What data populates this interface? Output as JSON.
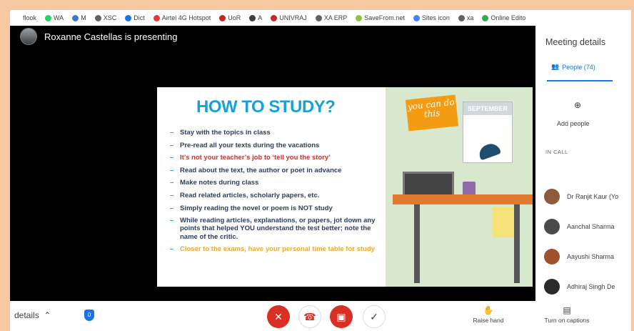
{
  "bookmarks": [
    {
      "label": "flook",
      "color": "#ffffff"
    },
    {
      "label": "WA",
      "color": "#25d366"
    },
    {
      "label": "M",
      "color": "#3c78d8"
    },
    {
      "label": "XSC",
      "color": "#5f6368"
    },
    {
      "label": "Dict",
      "color": "#1a73e8"
    },
    {
      "label": "Airtel 4G Hotspot",
      "color": "#e53935"
    },
    {
      "label": "UoR",
      "color": "#c62828"
    },
    {
      "label": "A",
      "color": "#3c4043"
    },
    {
      "label": "UNIVRAJ",
      "color": "#c62828"
    },
    {
      "label": "XA ERP",
      "color": "#5f6368"
    },
    {
      "label": "SaveFrom.net",
      "color": "#8bc34a"
    },
    {
      "label": "Sites icon",
      "color": "#4285f4"
    },
    {
      "label": "xa",
      "color": "#5f6368"
    },
    {
      "label": "Online Edito",
      "color": "#34a853"
    }
  ],
  "presenter": {
    "text": "Roxanne Castellas is presenting"
  },
  "slide": {
    "title": "HOW TO STUDY?",
    "bullets": [
      {
        "text": "Stay with the topics in class",
        "style": "dark"
      },
      {
        "text": "Pre-read all your texts during the vacations",
        "style": "dark"
      },
      {
        "text": "It’s not your teacher’s job to ‘tell you the story’",
        "style": "red"
      },
      {
        "text": "Read about the text, the author or poet in advance",
        "style": "dark"
      },
      {
        "text": "Make notes during class",
        "style": "dark"
      },
      {
        "text": "Read related articles, scholarly papers, etc.",
        "style": "dark"
      },
      {
        "text": "Simply reading the novel or poem is NOT study",
        "style": "dark"
      },
      {
        "text": "While reading articles, explanations, or papers, jot down any points that helped YOU understand the test better; note the name of the critic.",
        "style": "dark"
      },
      {
        "text": "Closer to the exams, have your personal time table for study",
        "style": "orange"
      }
    ],
    "sticky_note": "you can do this",
    "calendar_month": "SEPTEMBER"
  },
  "sidebar": {
    "title": "Meeting details",
    "people_tab": "People (74)",
    "add_people": "Add people",
    "in_call": "IN CALL",
    "people": [
      {
        "name": "Dr Ranjit Kaur (Yo",
        "color": "#8d5a3b"
      },
      {
        "name": "Aanchal Sharma",
        "color": "#4a4a4a"
      },
      {
        "name": "Aayushi Sharma",
        "color": "#a0522d"
      },
      {
        "name": "Adhiraj Singh De",
        "color": "#2b2b2b"
      }
    ]
  },
  "bottom": {
    "details": "details",
    "raise_hand": "Raise hand",
    "captions": "Turn on captions"
  }
}
